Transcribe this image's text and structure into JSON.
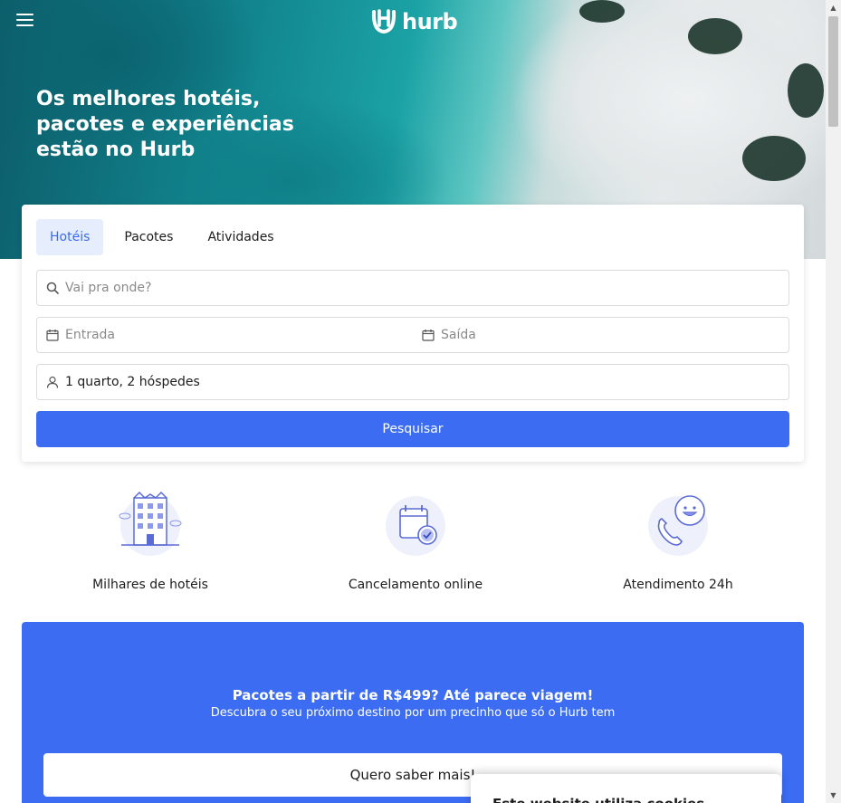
{
  "header": {
    "menu_icon": "hamburger-menu-icon",
    "logo_text": "hurb",
    "logo_icon": "hurb-logo-icon"
  },
  "hero": {
    "title": "Os melhores hotéis, pacotes e experiências estão no Hurb"
  },
  "search": {
    "tabs": [
      {
        "label": "Hotéis",
        "active": true
      },
      {
        "label": "Pacotes",
        "active": false
      },
      {
        "label": "Atividades",
        "active": false
      }
    ],
    "destination_placeholder": "Vai pra onde?",
    "checkin_placeholder": "Entrada",
    "checkout_placeholder": "Saída",
    "guests_value": "1 quarto, 2 hóspedes",
    "submit_label": "Pesquisar"
  },
  "features": [
    {
      "label": "Milhares de hotéis",
      "icon": "hotel-building-icon"
    },
    {
      "label": "Cancelamento online",
      "icon": "calendar-check-icon"
    },
    {
      "label": "Atendimento 24h",
      "icon": "phone-chat-icon"
    }
  ],
  "promo": {
    "title": "Pacotes a partir de R$499? Até parece viagem!",
    "subtitle": "Descubra o seu próximo destino por um precinho que só o Hurb tem",
    "button_label": "Quero saber mais!"
  },
  "cookie_popup": {
    "title": "Este website utiliza cookies"
  },
  "colors": {
    "primary": "#3b6cf2",
    "tab_active_bg": "#e6edfd",
    "tab_active_text": "#3a6bee"
  }
}
